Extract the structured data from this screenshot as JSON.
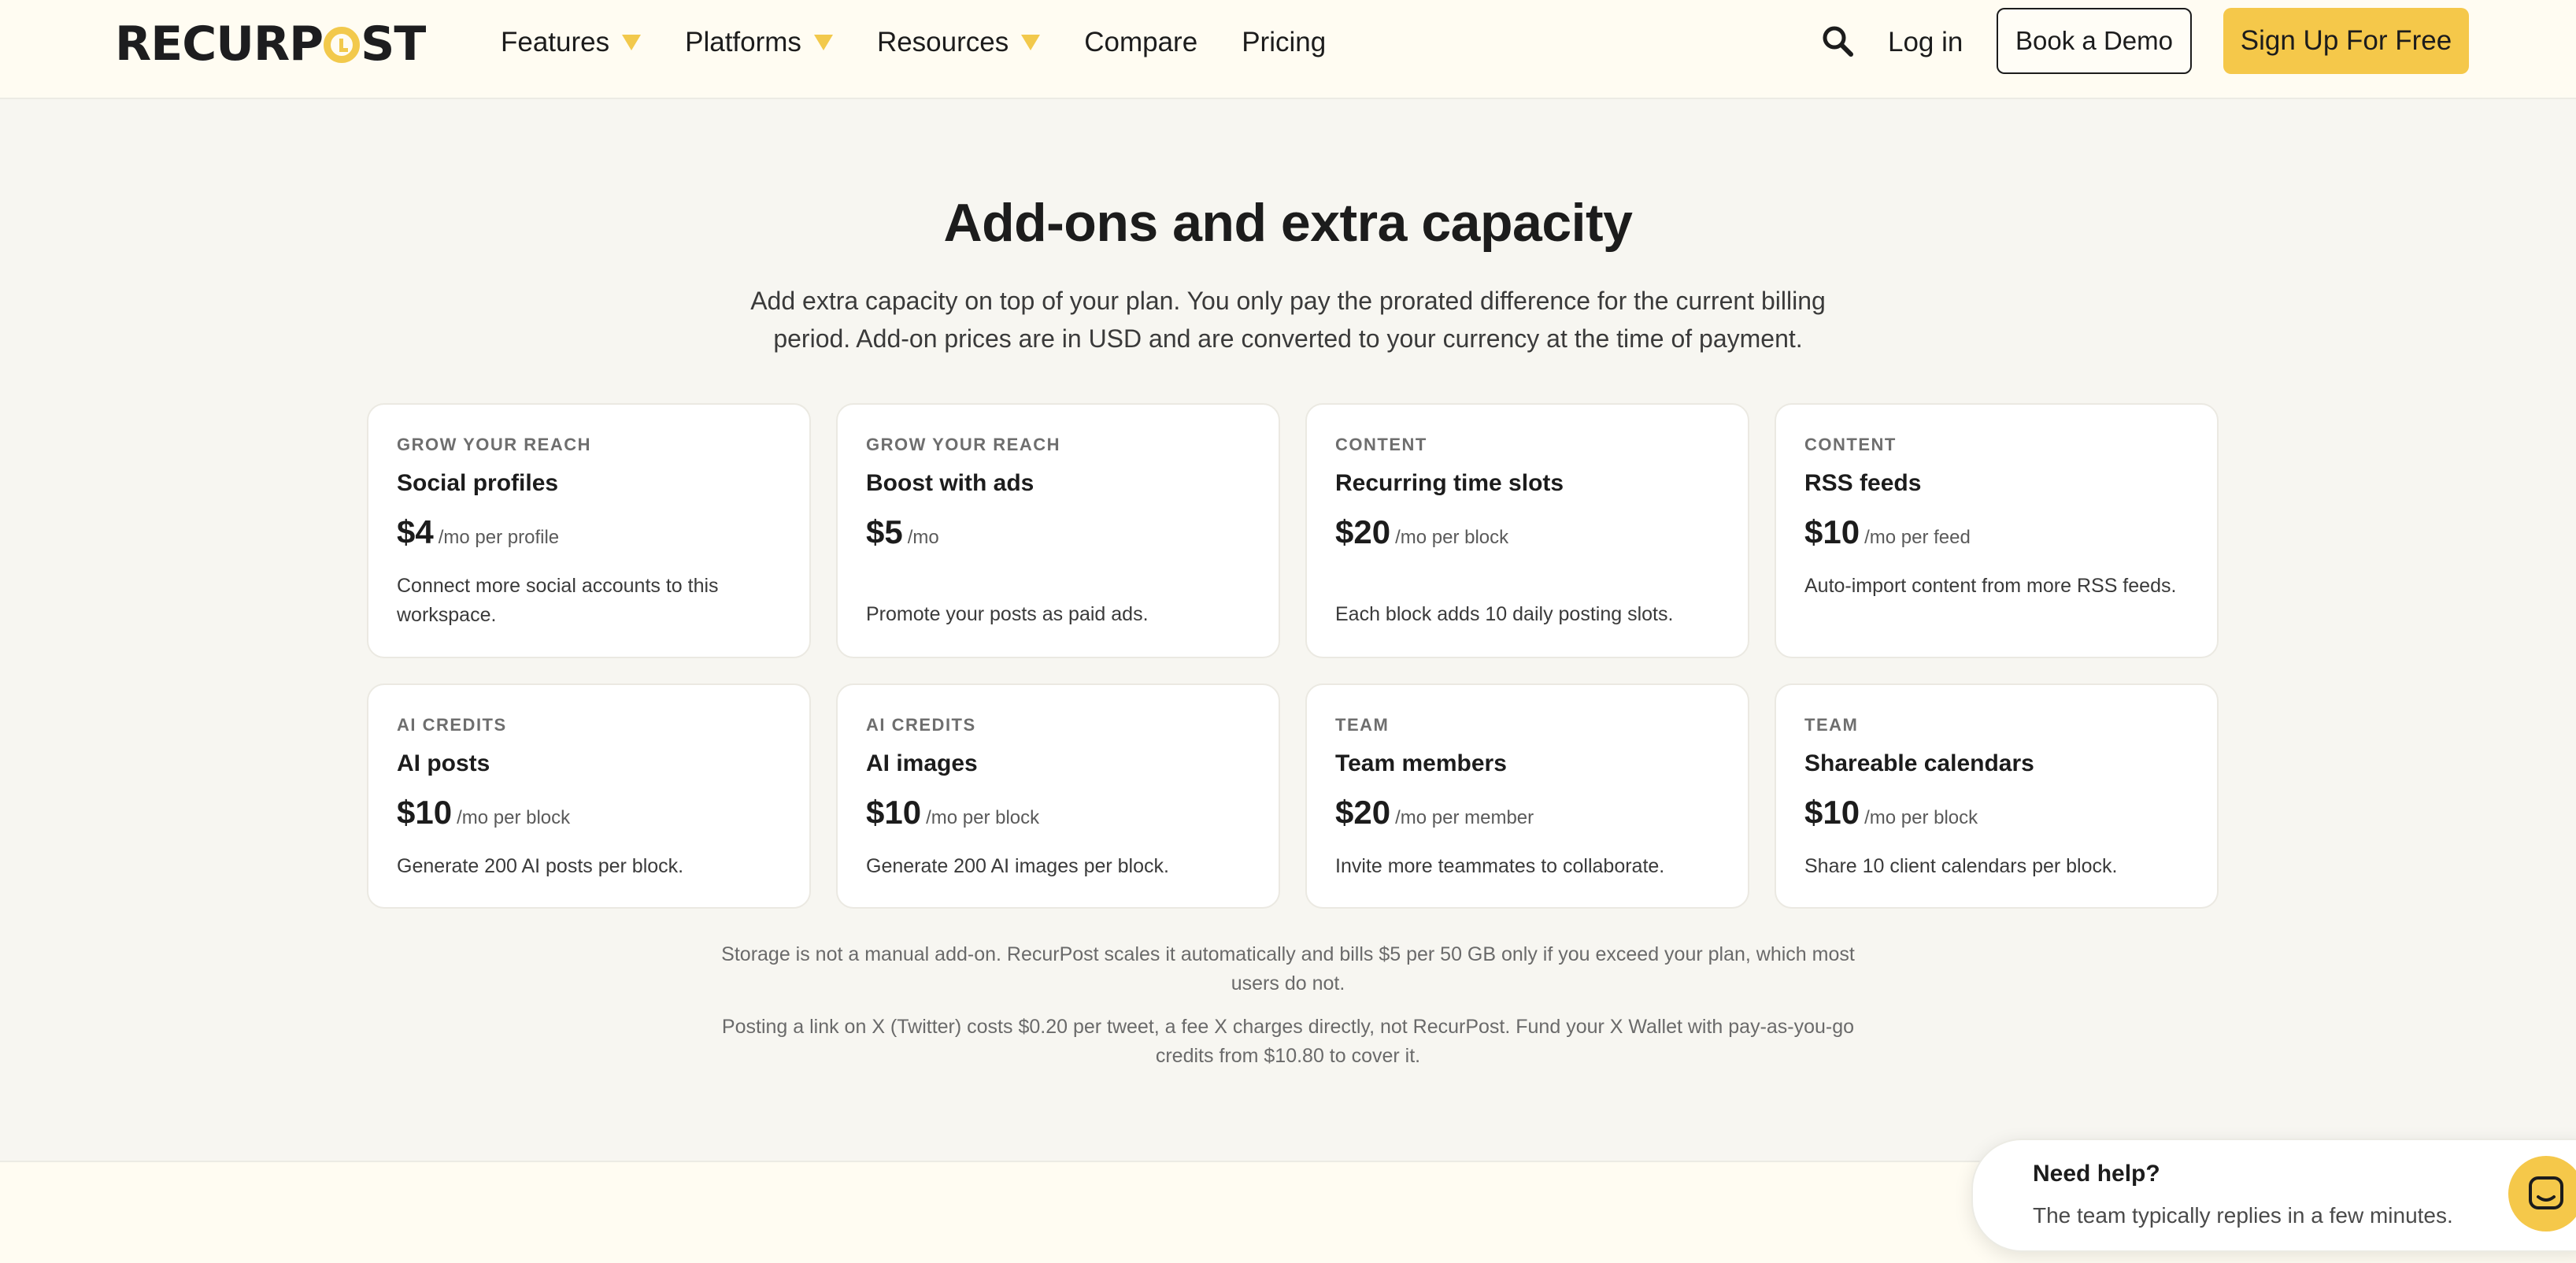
{
  "header": {
    "logo_text": "RECURPOST",
    "logo_left": "RECURP",
    "logo_right": "ST",
    "nav": [
      {
        "label": "Features",
        "has_caret": true
      },
      {
        "label": "Platforms",
        "has_caret": true
      },
      {
        "label": "Resources",
        "has_caret": true
      },
      {
        "label": "Compare",
        "has_caret": false
      },
      {
        "label": "Pricing",
        "has_caret": false
      }
    ],
    "login_label": "Log in",
    "demo_label": "Book a Demo",
    "signup_label": "Sign Up For Free",
    "accent_color": "#f5c84a",
    "search_icon": "search-icon"
  },
  "main": {
    "title": "Add-ons and extra capacity",
    "subtitle": "Add extra capacity on top of your plan. You only pay the prorated difference for the current billing period. Add-on prices are in USD and are converted to your currency at the time of payment.",
    "addons": [
      {
        "category": "GROW YOUR REACH",
        "name": "Social profiles",
        "price": "$4",
        "unit": "/mo per profile",
        "desc": "Connect more social accounts to this workspace."
      },
      {
        "category": "GROW YOUR REACH",
        "name": "Boost with ads",
        "price": "$5",
        "unit": "/mo",
        "desc": "Promote your posts as paid ads."
      },
      {
        "category": "CONTENT",
        "name": "Recurring time slots",
        "price": "$20",
        "unit": "/mo per block",
        "desc": "Each block adds 10 daily posting slots."
      },
      {
        "category": "CONTENT",
        "name": "RSS feeds",
        "price": "$10",
        "unit": "/mo per feed",
        "desc": "Auto-import content from more RSS feeds."
      },
      {
        "category": "AI CREDITS",
        "name": "AI posts",
        "price": "$10",
        "unit": "/mo per block",
        "desc": "Generate 200 AI posts per block."
      },
      {
        "category": "AI CREDITS",
        "name": "AI images",
        "price": "$10",
        "unit": "/mo per block",
        "desc": "Generate 200 AI images per block."
      },
      {
        "category": "TEAM",
        "name": "Team members",
        "price": "$20",
        "unit": "/mo per member",
        "desc": "Invite more teammates to collaborate."
      },
      {
        "category": "TEAM",
        "name": "Shareable calendars",
        "price": "$10",
        "unit": "/mo per block",
        "desc": "Share 10 client calendars per block."
      }
    ],
    "note_storage": "Storage is not a manual add-on. RecurPost scales it automatically and bills $5 per 50 GB only if you exceed your plan, which most users do not.",
    "note_x": "Posting a link on X (Twitter) costs $0.20 per tweet, a fee X charges directly, not RecurPost. Fund your X Wallet with pay-as-you-go credits from $10.80 to cover it."
  },
  "help": {
    "title": "Need help?",
    "text": "The team typically replies in a few minutes.",
    "icon": "chat-icon"
  }
}
